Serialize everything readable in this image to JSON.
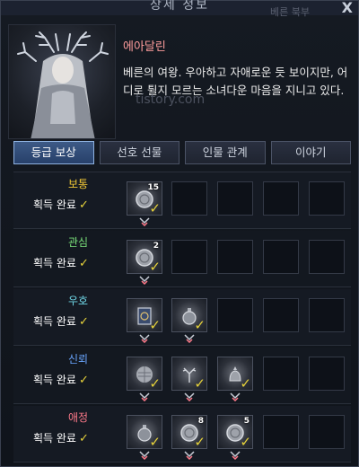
{
  "window": {
    "title": "상세 정보",
    "title_ghost": "베른 북부",
    "close_label": "X"
  },
  "character": {
    "name": "에아달린",
    "description": "베른의 여왕. 우아하고 자애로운 듯 보이지만, 어디로 튈지 모르는 소녀다운 마음을 지니고 있다.",
    "watermark": "tistory.com"
  },
  "tabs": [
    {
      "label": "등급 보상",
      "active": true
    },
    {
      "label": "선호 선물",
      "active": false
    },
    {
      "label": "인물 관계",
      "active": false
    },
    {
      "label": "이야기",
      "active": false
    }
  ],
  "status_label": "획득 완료",
  "rows": [
    {
      "grade": "보통",
      "color": "#f3c936",
      "slots": [
        {
          "type": "coin",
          "count": "15",
          "checked": true
        },
        null,
        null,
        null,
        null
      ]
    },
    {
      "grade": "관심",
      "color": "#7ae07a",
      "slots": [
        {
          "type": "coin",
          "count": "2",
          "checked": true
        },
        null,
        null,
        null,
        null
      ]
    },
    {
      "grade": "우호",
      "color": "#6fd6e6",
      "slots": [
        {
          "type": "card",
          "count": "",
          "checked": true
        },
        {
          "type": "potion",
          "count": "",
          "checked": true
        },
        null,
        null,
        null
      ]
    },
    {
      "grade": "신뢰",
      "color": "#6aa6ff",
      "slots": [
        {
          "type": "orb",
          "count": "",
          "checked": true
        },
        {
          "type": "antler",
          "count": "",
          "checked": true
        },
        {
          "type": "bell",
          "count": "",
          "checked": true
        },
        null,
        null
      ]
    },
    {
      "grade": "애정",
      "color": "#ff7a8a",
      "slots": [
        {
          "type": "potion",
          "count": "",
          "checked": true
        },
        {
          "type": "coin",
          "count": "8",
          "checked": true
        },
        {
          "type": "coin",
          "count": "5",
          "checked": true
        },
        null,
        null
      ]
    }
  ],
  "colors": {
    "accent": "#8fb2e0",
    "check": "#e6d23b",
    "name": "#ff9d9d"
  }
}
